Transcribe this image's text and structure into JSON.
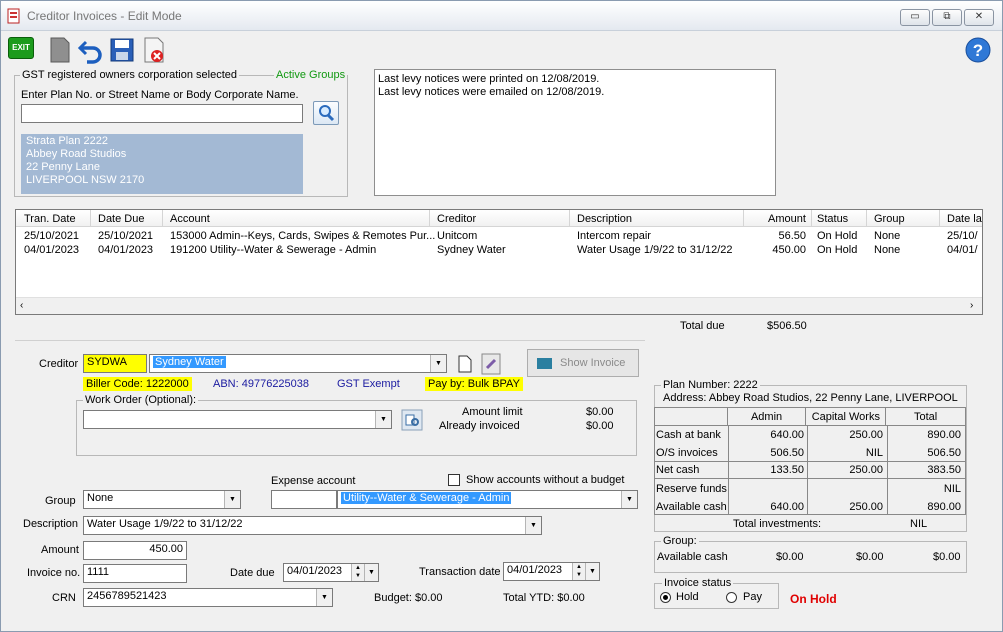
{
  "window": {
    "title": "Creditor Invoices - Edit Mode",
    "min": "▭",
    "max": "⧉",
    "close": "✕"
  },
  "toolbar": {
    "exit": "EXIT",
    "help": "?"
  },
  "plan_box": {
    "legend": "GST registered owners corporation selected",
    "active_groups": "Active Groups",
    "search_label": "Enter Plan No. or Street Name or Body Corporate Name.",
    "search_value": "",
    "lines": [
      "Strata Plan 2222",
      "Abbey Road Studios",
      "22 Penny Lane",
      "LIVERPOOL  NSW  2170"
    ]
  },
  "notices": [
    "Last levy notices were printed on 12/08/2019.",
    "Last levy notices were emailed on 12/08/2019."
  ],
  "invoices": {
    "columns": [
      "Tran. Date",
      "Date Due",
      "Account",
      "Creditor",
      "Description",
      "Amount",
      "Status",
      "Group",
      "Date la"
    ],
    "rows": [
      [
        "25/10/2021",
        "25/10/2021",
        "153000  Admin--Keys, Cards, Swipes & Remotes Pur...",
        "Unitcom",
        "Intercom repair",
        "56.50",
        "On Hold",
        "None",
        "25/10/"
      ],
      [
        "04/01/2023",
        "04/01/2023",
        "191200  Utility--Water & Sewerage - Admin",
        "Sydney Water",
        "Water Usage 1/9/22 to 31/12/22",
        "450.00",
        "On Hold",
        "None",
        "04/01/"
      ]
    ],
    "total_label": "Total due",
    "total_value": "$506.50"
  },
  "form": {
    "creditor_label": "Creditor",
    "creditor_code": "SYDWA",
    "creditor_name": "Sydney Water",
    "show_invoice": "Show Invoice",
    "biller": "Biller Code: 1222000",
    "abn": "ABN: 49776225038",
    "gst": "GST Exempt",
    "payby": "Pay by: Bulk BPAY",
    "work_order_legend": "Work Order (Optional):",
    "amount_limit_label": "Amount limit",
    "amount_limit": "$0.00",
    "already_label": "Already invoiced",
    "already": "$0.00",
    "expense_label": "Expense account",
    "show_accounts": "Show accounts without a budget",
    "expense_code": "",
    "expense_name": "Utility--Water & Sewerage - Admin",
    "group_label": "Group",
    "group_value": "None",
    "description_label": "Description",
    "description_value": "Water Usage 1/9/22 to 31/12/22",
    "amount_label": "Amount",
    "amount_value": "450.00",
    "invoice_label": "Invoice no.",
    "invoice_value": "1111",
    "date_due_label": "Date due",
    "date_due": "04/01/2023",
    "tran_label": "Transaction date",
    "tran_date": "04/01/2023",
    "crn_label": "CRN",
    "crn_value": "2456789521423",
    "budget": "Budget: $0.00",
    "ytd": "Total YTD: $0.00"
  },
  "summary": {
    "plan_number": "Plan Number: 2222",
    "address": "Address: Abbey Road Studios, 22 Penny Lane, LIVERPOOL",
    "headers": [
      "",
      "Admin",
      "Capital Works",
      "Total"
    ],
    "rows": [
      [
        "Cash at bank",
        "640.00",
        "250.00",
        "890.00"
      ],
      [
        "O/S invoices",
        "506.50",
        "NIL",
        "506.50"
      ],
      [
        "Net cash",
        "133.50",
        "250.00",
        "383.50"
      ],
      [
        "Reserve funds",
        "",
        "",
        "NIL"
      ],
      [
        "Available cash",
        "640.00",
        "250.00",
        "890.00"
      ]
    ],
    "investments_label": "Total investments:",
    "investments": "NIL",
    "group_legend": "Group:",
    "group_avail": "Available cash",
    "group_vals": [
      "$0.00",
      "$0.00",
      "$0.00"
    ]
  },
  "status": {
    "legend": "Invoice status",
    "hold": "Hold",
    "pay": "Pay",
    "state": "On Hold"
  },
  "colors": {
    "selection": "#3399ff",
    "highlight": "#ffff00",
    "plan_panel": "#a3b9d4",
    "on_hold": "#e00000",
    "active_groups": "#119911"
  }
}
